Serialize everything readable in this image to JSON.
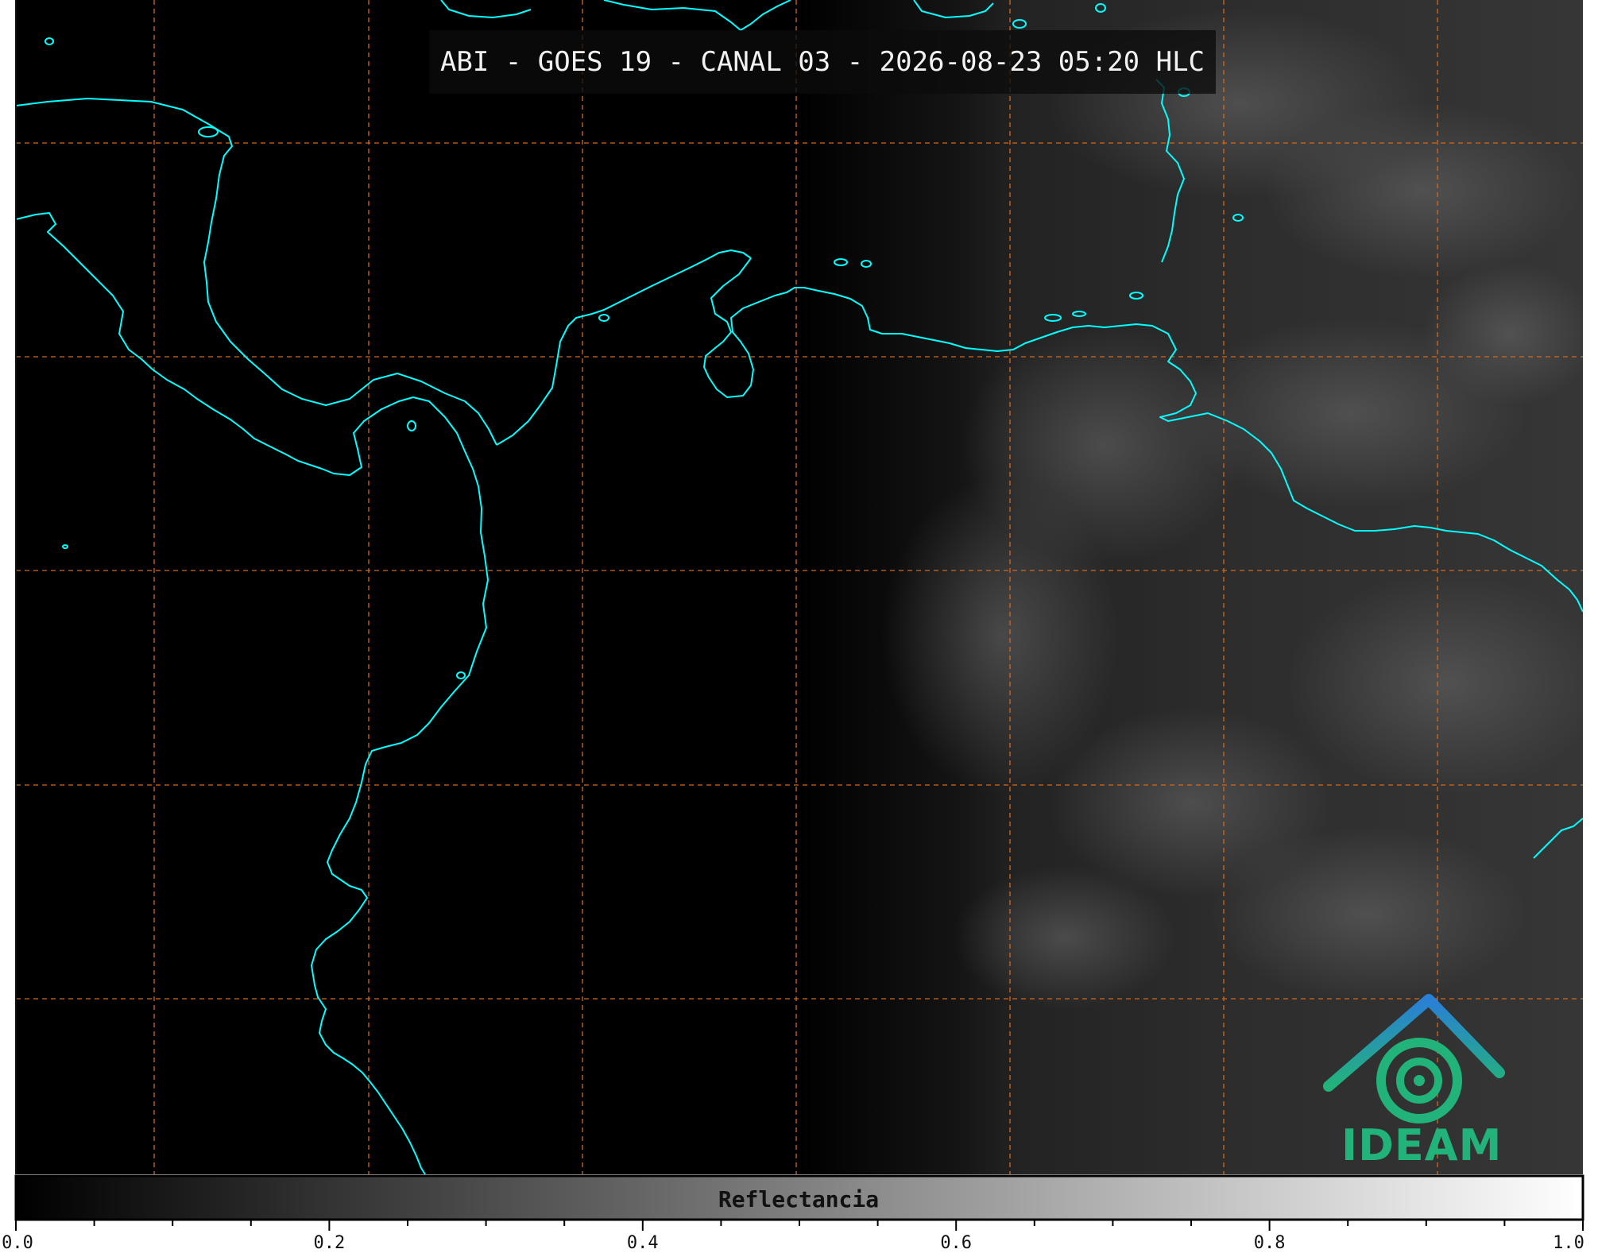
{
  "title": "ABI - GOES 19 - CANAL 03 - 2026-08-23 05:20 HLC",
  "logo": {
    "text": "IDEAM"
  },
  "colorbar": {
    "label": "Reflectancia",
    "range": [
      0.0,
      1.0
    ],
    "colormap": "grayscale",
    "major_ticks": [
      {
        "value": 0.0,
        "label": "0.0"
      },
      {
        "value": 0.2,
        "label": "0.2"
      },
      {
        "value": 0.4,
        "label": "0.4"
      },
      {
        "value": 0.6,
        "label": "0.6"
      },
      {
        "value": 0.8,
        "label": "0.8"
      },
      {
        "value": 1.0,
        "label": "1.0"
      }
    ],
    "minor_step": 0.05
  },
  "colors": {
    "coastline": "#00ffff",
    "gridlines": "#d2691e",
    "background": "#000000",
    "logo_green": "#22b37a",
    "logo_blue": "#2a7fd6"
  }
}
